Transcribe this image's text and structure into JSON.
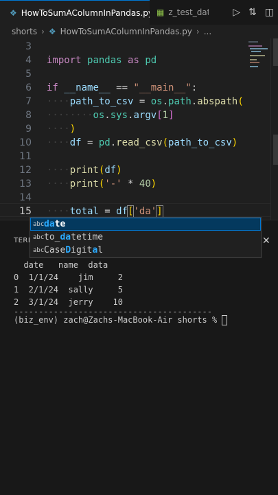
{
  "tabs": [
    {
      "label": "HowToSumAColumnInPandas.py",
      "status": "U",
      "active": true
    },
    {
      "label": "z_test_data.c",
      "active": false
    }
  ],
  "breadcrumb": {
    "folder": "shorts",
    "file": "HowToSumAColumnInPandas.py",
    "more": "..."
  },
  "editor": {
    "line_numbers": [
      "3",
      "4",
      "5",
      "6",
      "7",
      "8",
      "9",
      "10",
      "11",
      "12",
      "13",
      "14",
      "15"
    ],
    "active_line": "15",
    "code": {
      "l4_import": "import",
      "l4_pandas": "pandas",
      "l4_as": "as",
      "l4_pd": "pd",
      "l6_if": "if",
      "l6_name": "__name__",
      "l6_eq": "==",
      "l6_main": "\"__main__\"",
      "l6_colon": ":",
      "l7_var": "path_to_csv",
      "l7_assign": "=",
      "l7_os": "os",
      "l7_path": "path",
      "l7_fn": "abspath",
      "l8_os": "os",
      "l8_sys": "sys",
      "l8_argv": "argv",
      "l8_idx": "1",
      "l10_df": "df",
      "l10_pd": "pd",
      "l10_fn": "read_csv",
      "l10_arg": "path_to_csv",
      "l12_fn": "print",
      "l12_arg": "df",
      "l13_fn": "print",
      "l13_str": "'-'",
      "l13_mul": "*",
      "l13_num": "40",
      "l15_var": "total",
      "l15_df": "df",
      "l15_str": "'da'"
    }
  },
  "suggestions": [
    {
      "kind": "abc",
      "match": "da",
      "rest": "te",
      "selected": true
    },
    {
      "kind": "abc",
      "pre": "to_",
      "match": "da",
      "rest": "tetime",
      "selected": false
    },
    {
      "kind": "abc",
      "pre": "Case",
      "m1": "D",
      "mid": "igit",
      "m2": "a",
      "rest": "l",
      "selected": false
    }
  ],
  "panel": {
    "title": "TERM",
    "terminal_lines": [
      "  date   name  data",
      "0  1/1/24    jim     2",
      "1  2/1/24  sally     5",
      "2  3/1/24  jerry    10",
      "----------------------------------------",
      "(biz_env) zach@Zachs-MacBook-Air shorts % "
    ]
  },
  "colors": {
    "accent": "#0078d4",
    "keyword": "#c586c0",
    "string": "#ce9178",
    "function": "#dcdcaa",
    "variable": "#9cdcfe"
  }
}
